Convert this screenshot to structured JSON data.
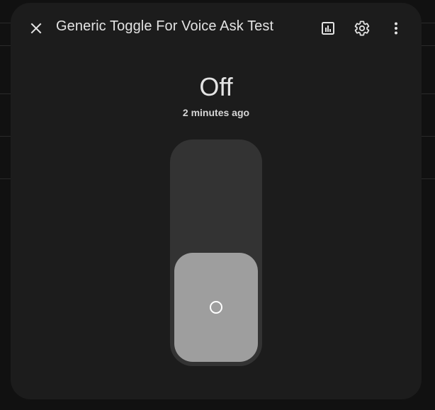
{
  "dialog": {
    "title": "Generic Toggle For Voice Ask Test",
    "icons": {
      "close": "close-icon",
      "history": "chart-bar-icon",
      "settings": "gear-icon",
      "menu": "more-vertical-icon"
    }
  },
  "state": {
    "value": "Off",
    "last_changed": "2 minutes ago"
  },
  "toggle": {
    "is_on": false,
    "thumb_icon": "circle-outline-icon"
  },
  "colors": {
    "background": "#111111",
    "dialog": "#1c1c1c",
    "track": "#333333",
    "thumb_off": "#9e9e9e",
    "text": "#e3e3e3"
  }
}
